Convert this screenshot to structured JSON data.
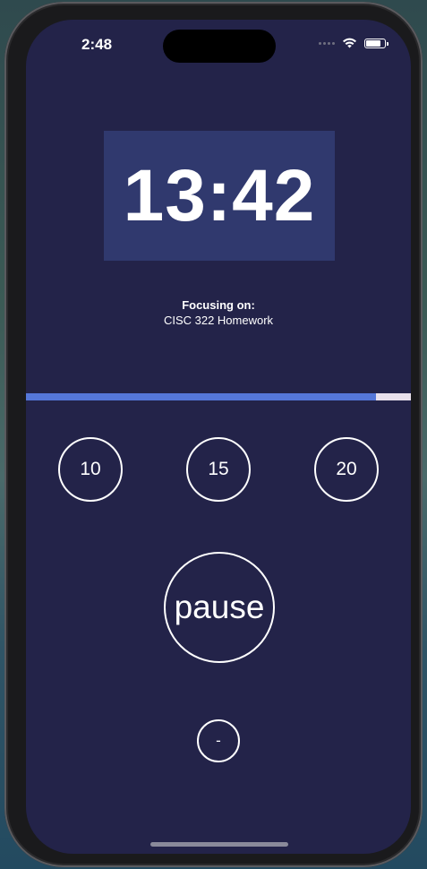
{
  "status_bar": {
    "time": "2:48",
    "icons": [
      "cellular-signal-icon",
      "wifi-icon",
      "battery-icon"
    ]
  },
  "timer": {
    "display": "13:42"
  },
  "focus": {
    "label": "Focusing on:",
    "task": "CISC 322 Homework"
  },
  "progress": {
    "fraction": 0.91
  },
  "presets": [
    {
      "label": "10"
    },
    {
      "label": "15"
    },
    {
      "label": "20"
    }
  ],
  "controls": {
    "pause_label": "pause",
    "minus_label": "-"
  },
  "colors": {
    "background": "#232349",
    "timer_box": "#30396e",
    "progress_fill": "#5577d9",
    "progress_track": "#e8e0ec",
    "text": "#ffffff"
  }
}
